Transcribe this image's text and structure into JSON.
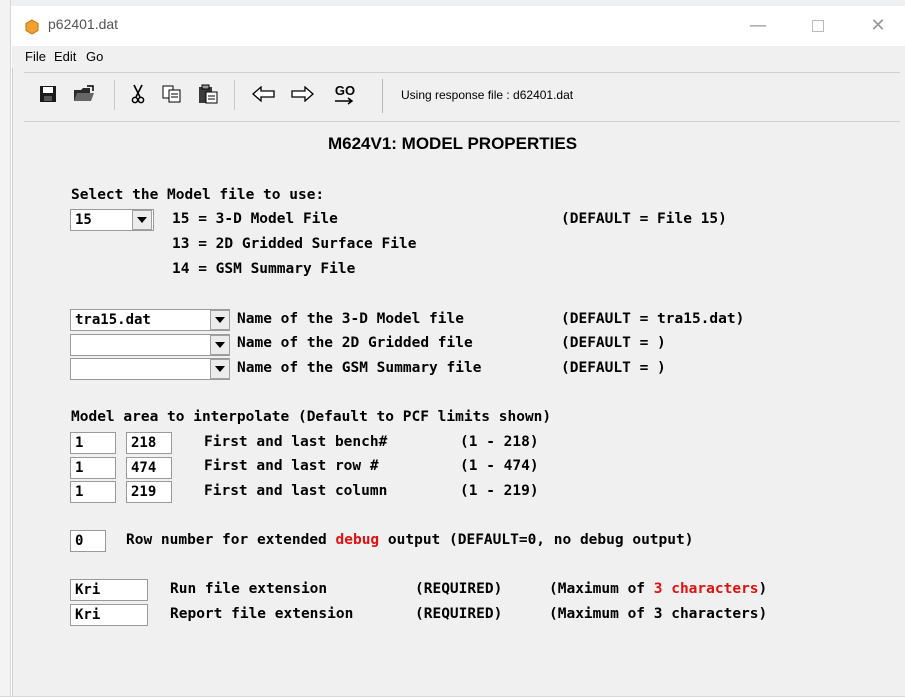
{
  "window": {
    "title": "p62401.dat"
  },
  "menu": {
    "file": "File",
    "edit": "Edit",
    "go": "Go"
  },
  "toolbar": {
    "icons": [
      "save-icon",
      "open-icon",
      "cut-icon",
      "copy-icon",
      "paste-icon",
      "back-arrow-icon",
      "forward-arrow-icon",
      "go-icon"
    ],
    "go_label": "GO",
    "status": "Using response file : d62401.dat"
  },
  "panel": {
    "title": "M624V1: MODEL PROPERTIES"
  },
  "model_select": {
    "heading": "Select the Model file to use:",
    "value": "15",
    "options": [
      {
        "text": "15 = 3-D Model File",
        "default": "(DEFAULT = File 15)"
      },
      {
        "text": "13 = 2D Gridded Surface File",
        "default": ""
      },
      {
        "text": "14 = GSM Summary File",
        "default": ""
      }
    ]
  },
  "file_names": [
    {
      "value": "tra15.dat",
      "label": "Name of the 3-D Model file  ",
      "default": "(DEFAULT = tra15.dat)"
    },
    {
      "value": "",
      "label": "Name of the 2D Gridded file  ",
      "default": "(DEFAULT = )"
    },
    {
      "value": "",
      "label": "Name of the GSM Summary file ",
      "default": "(DEFAULT = )"
    }
  ],
  "area": {
    "heading": "Model area to interpolate (Default to PCF limits shown)",
    "rows": [
      {
        "first": "1",
        "last": "218",
        "label": "First and last bench#",
        "range": "(1 - 218)"
      },
      {
        "first": "1",
        "last": "474",
        "label": "First and last row #",
        "range": "(1 - 474)"
      },
      {
        "first": "1",
        "last": "219",
        "label": "First and last column",
        "range": "(1 - 219)"
      }
    ]
  },
  "debug": {
    "value": "0",
    "label_pre": "Row number for extended ",
    "label_red": "debug",
    "label_post": " output (DEFAULT=0, no debug output)"
  },
  "extensions": [
    {
      "value": "Kri",
      "label": "Run file extension",
      "req": "(REQUIRED)",
      "max_pre": "(Maximum of ",
      "max_red": "3 characters",
      "max_post": ")"
    },
    {
      "value": "Kri",
      "label": "Report file extension",
      "req": "(REQUIRED)",
      "max_pre": "(Maximum of 3 characters)",
      "max_red": "",
      "max_post": ""
    }
  ],
  "colors": {
    "accent_red": "#e01010",
    "app_icon": "#f0a030"
  }
}
